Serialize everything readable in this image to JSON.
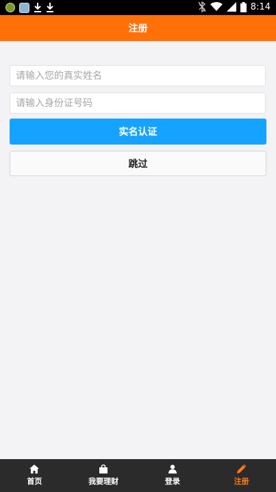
{
  "status_bar": {
    "time": "8:14",
    "icons": [
      "app-icon",
      "image-icon",
      "download-icon",
      "download-icon",
      "bluetooth-off-icon",
      "wifi-icon",
      "signal-icon",
      "battery-icon"
    ]
  },
  "header": {
    "title": "注册"
  },
  "form": {
    "name_placeholder": "请输入您的真实姓名",
    "id_placeholder": "请输入身份证号码",
    "verify_label": "实名认证",
    "skip_label": "跳过"
  },
  "tabs": [
    {
      "label": "首页",
      "icon": "home-icon"
    },
    {
      "label": "我要理财",
      "icon": "bag-icon"
    },
    {
      "label": "登录",
      "icon": "user-icon"
    },
    {
      "label": "注册",
      "icon": "pencil-icon",
      "active": true
    }
  ],
  "colors": {
    "accent": "#ff7108",
    "primary_button": "#16a3ff",
    "tabbar": "#2b2b2b",
    "active_tab": "#ff7a1a"
  }
}
